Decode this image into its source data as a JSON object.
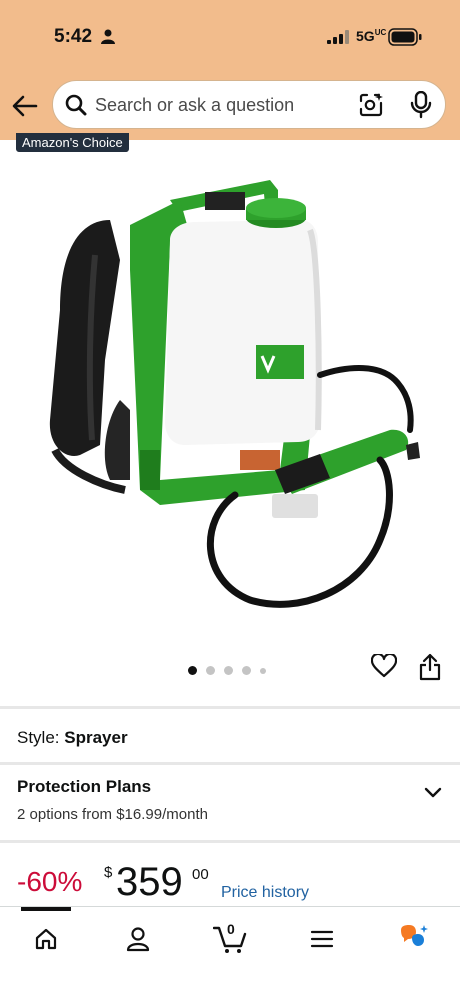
{
  "status_bar": {
    "time": "5:42",
    "network": "5G",
    "network_suffix": "UC"
  },
  "header": {
    "search_placeholder": "Search or ask a question"
  },
  "product": {
    "badge": "Amazon's Choice",
    "image_count": 5,
    "active_image": 1
  },
  "style": {
    "label": "Style:",
    "value": "Sprayer"
  },
  "protection": {
    "title": "Protection Plans",
    "subtitle": "2 options from $16.99/month"
  },
  "pricing": {
    "discount": "-60%",
    "currency_symbol": "$",
    "whole": "359",
    "fraction": "00",
    "history_link": "Price history"
  },
  "tabbar": {
    "cart_count": "0"
  },
  "colors": {
    "header_bg": "#f2bc8c",
    "discount": "#cc0c39",
    "link": "#2162a1",
    "sprayer_green": "#2ea12c"
  }
}
